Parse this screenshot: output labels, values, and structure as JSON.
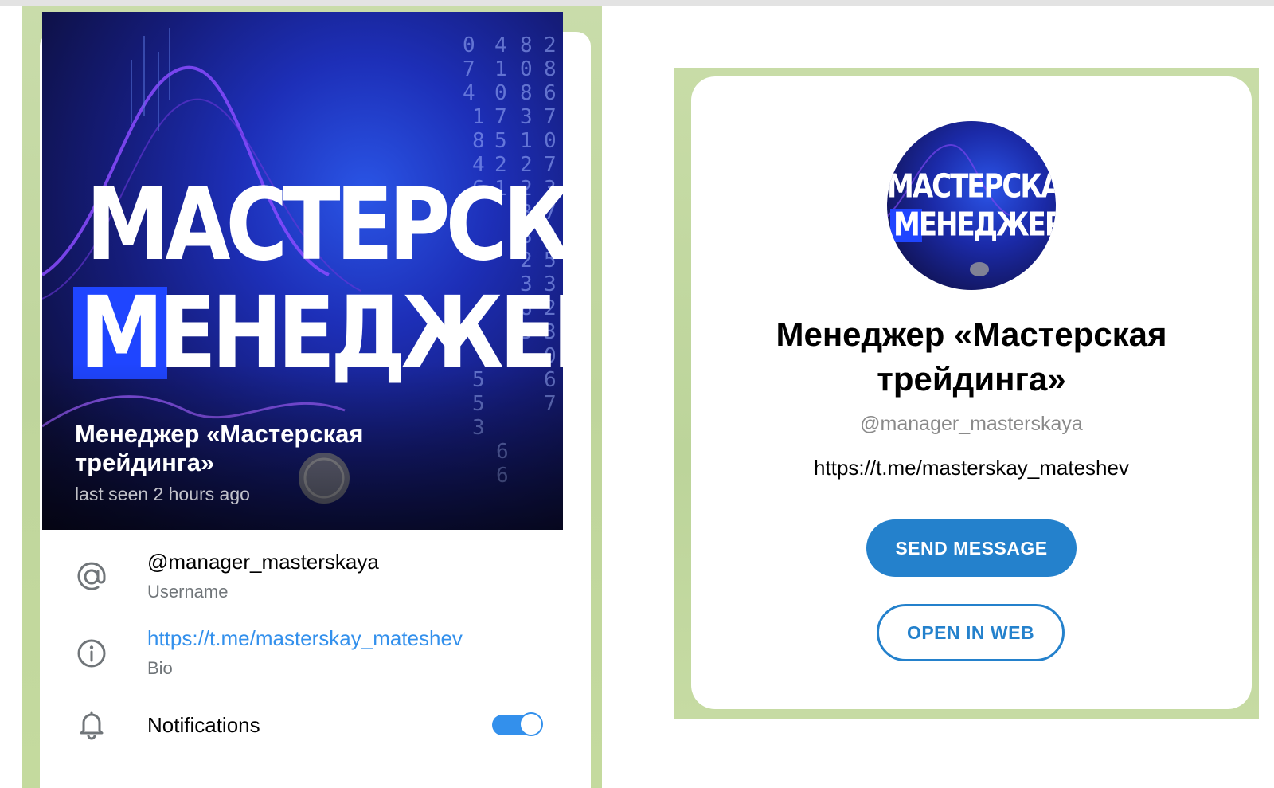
{
  "profile": {
    "cover_logo_line1": "МАСТЕРСКАЯ",
    "cover_logo_line2": "МЕНЕДЖЕР",
    "name": "Менеджер «Мастерская трейдинга»",
    "status": "last seen 2 hours ago",
    "username_value": "@manager_masterskaya",
    "username_label": "Username",
    "bio_value": "https://t.me/masterskay_mateshev",
    "bio_label": "Bio",
    "notifications_label": "Notifications",
    "notifications_on": true
  },
  "preview": {
    "avatar_line1": "МАСТЕРСКАЯ",
    "avatar_line2": "МЕНЕДЖЕР",
    "title": "Менеджер «Мастерская трейдинга»",
    "username": "@manager_masterskaya",
    "bio": "https://t.me/masterskay_mateshev",
    "send_button": "SEND MESSAGE",
    "web_button": "OPEN IN WEB"
  },
  "colors": {
    "accent": "#2481cc",
    "link": "#3390ec",
    "chat_bg": "#c4d9a1"
  },
  "icons": [
    "at-sign-icon",
    "info-icon",
    "bell-icon"
  ]
}
